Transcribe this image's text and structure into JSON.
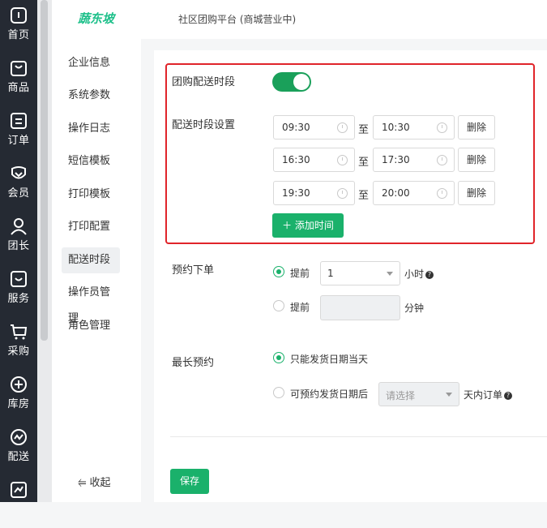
{
  "nav": [
    {
      "label": "首页",
      "icon": "home-icon"
    },
    {
      "label": "商品",
      "icon": "bag-icon"
    },
    {
      "label": "订单",
      "icon": "order-icon"
    },
    {
      "label": "会员",
      "icon": "member-icon"
    },
    {
      "label": "团长",
      "icon": "person-icon"
    },
    {
      "label": "服务",
      "icon": "service-icon"
    },
    {
      "label": "采购",
      "icon": "cart-icon"
    },
    {
      "label": "库房",
      "icon": "warehouse-icon"
    },
    {
      "label": "配送",
      "icon": "delivery-icon"
    },
    {
      "label": "",
      "icon": "chart-icon"
    }
  ],
  "brand": {
    "logo_text": "蔬东坡",
    "color": "#1dc08a"
  },
  "header": {
    "title": "社区团购平台 (商城营业中)"
  },
  "subnav": {
    "items": [
      "企业信息",
      "系统参数",
      "操作日志",
      "短信模板",
      "打印模板",
      "打印配置",
      "配送时段",
      "操作员管理",
      "角色管理"
    ],
    "active_index": 6,
    "collapse_label": "收起",
    "collapse_icon": "collapse-icon"
  },
  "form": {
    "delivery_slot_label": "团购配送时段",
    "delivery_slot_enabled": true,
    "slot_settings_label": "配送时段设置",
    "to_label": "至",
    "slots": [
      {
        "start": "09:30",
        "end": "10:30",
        "delete_label": "删除"
      },
      {
        "start": "16:30",
        "end": "17:30",
        "delete_label": "删除"
      },
      {
        "start": "19:30",
        "end": "20:00",
        "delete_label": "删除"
      }
    ],
    "add_time_label": "添加时间",
    "preorder": {
      "label": "预约下单",
      "option1_label": "提前",
      "option1_value": "1",
      "option1_unit": "小时",
      "option1_selected": true,
      "option2_label": "提前",
      "option2_value": "",
      "option2_unit": "分钟"
    },
    "max_preorder": {
      "label": "最长预约",
      "option1_label": "只能发货日期当天",
      "option1_selected": true,
      "option2_label": "可预约发货日期后",
      "option2_placeholder": "请选择",
      "option2_unit": "天内订单"
    },
    "save_label": "保存"
  },
  "colors": {
    "accent": "#1ab16b",
    "highlight_border": "#e0242a",
    "nav_bg": "#252a33"
  }
}
